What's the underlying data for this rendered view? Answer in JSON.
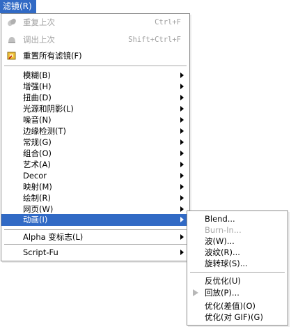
{
  "menubar": {
    "filters_label": "滤镜(R)"
  },
  "main_menu": {
    "repeat_last": {
      "label": "重复上次",
      "accel": "Ctrl+F"
    },
    "reshow_last": {
      "label": "调出上次",
      "accel": "Shift+Ctrl+F"
    },
    "reset_all": {
      "label": "重置所有滤镜(F)"
    },
    "items": [
      "模糊(B)",
      "增强(H)",
      "扭曲(D)",
      "光源和阴影(L)",
      "噪音(N)",
      "边缘检测(T)",
      "常规(G)",
      "组合(O)",
      "艺术(A)",
      "Decor",
      "映射(M)",
      "绘制(R)",
      "网页(W)",
      "动画(I)"
    ],
    "alpha_logo": "Alpha 变标志(L)",
    "script_fu": "Script-Fu"
  },
  "animation_submenu": {
    "items": [
      "Blend...",
      "Burn-In...",
      "波(W)...",
      "波纹(R)...",
      "旋转球(S)...",
      "反优化(U)",
      "回放(P)...",
      "优化(差值)(O)",
      "优化(对 GIF)(G)"
    ]
  }
}
